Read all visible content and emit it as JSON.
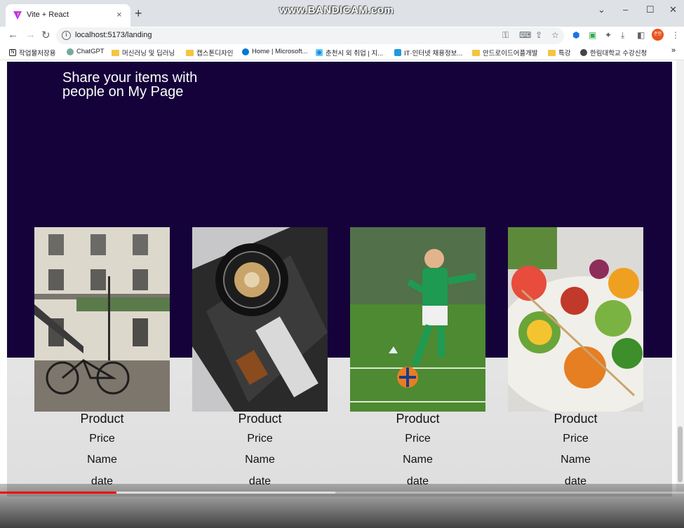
{
  "browser": {
    "tab_title": "Vite + React",
    "tab_close": "×",
    "new_tab": "+",
    "recording_watermark": "www.BANDICAM.com",
    "window_controls": {
      "dropdown": "⌄",
      "minimize": "–",
      "maximize": "☐",
      "close": "✕"
    },
    "url": "localhost:5173/landing",
    "profile_initials": "준현",
    "bookmarks": [
      {
        "label": "작업물저장용",
        "icon": "notion-icon"
      },
      {
        "label": "ChatGPT",
        "icon": "chatgpt-icon"
      },
      {
        "label": "머신러닝 및 딥러닝",
        "icon": "folder-icon"
      },
      {
        "label": "캡스톤디자인",
        "icon": "folder-icon"
      },
      {
        "label": "Home | Microsoft...",
        "icon": "microsoft-icon"
      },
      {
        "label": "춘천시 외 취업 | 지...",
        "icon": "dots-icon"
      },
      {
        "label": "IT·인터넷 채용정보...",
        "icon": "chat-icon"
      },
      {
        "label": "안드로이드어플개발",
        "icon": "folder-icon"
      },
      {
        "label": "특강",
        "icon": "folder-icon"
      },
      {
        "label": "한림대학교 수강신청",
        "icon": "globe-icon"
      }
    ],
    "bookmarks_overflow": "»"
  },
  "hero": {
    "text": "Share your items with people on My Page"
  },
  "products": [
    {
      "product": "Product",
      "price": "Price",
      "name": "Name",
      "date": "date",
      "image": "building-bicycle-photo"
    },
    {
      "product": "Product",
      "price": "Price",
      "name": "Name",
      "date": "date",
      "image": "canon-camera-photo"
    },
    {
      "product": "Product",
      "price": "Price",
      "name": "Name",
      "date": "date",
      "image": "boy-soccer-photo"
    },
    {
      "product": "Product",
      "price": "Price",
      "name": "Name",
      "date": "date",
      "image": "vegetable-skewers-photo"
    }
  ],
  "video_player": {
    "progress_played": 0.17,
    "progress_buffered": 0.49,
    "played_color": "#ff0000"
  },
  "colors": {
    "hero_bg": "#15023a",
    "tab_strip": "#dee1e6"
  }
}
